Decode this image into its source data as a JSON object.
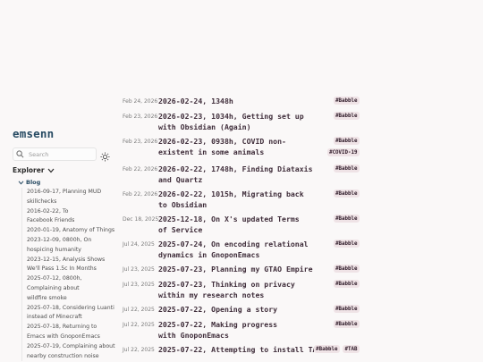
{
  "site": {
    "title": "emsenn"
  },
  "search": {
    "placeholder": "Search"
  },
  "icons": {
    "search": "search-icon",
    "darkmode": "sun-icon",
    "chevron": "chevron-down-icon"
  },
  "explorer": {
    "title": "Explorer",
    "folder": "Blog",
    "items": [
      "2016-09-17, Planning MUD",
      "skillchecks",
      "2016-02-22, To",
      "Facebook Friends",
      "2020-01-19, Anatomy of Things",
      "2023-12-09, 0800h, On",
      "hospicing humanity",
      "2023-12-15, Analysis Shows",
      "We'll Pass 1.5c In Months",
      "2025-07-12, 0800h,",
      "Complaining about",
      "wildfire smoke",
      "2025-07-18, Considering Luanti",
      "instead of Minecraft",
      "2025-07-18, Returning to",
      "Emacs with GnoponEmacs",
      "2025-07-19, Complaining about",
      "nearby construction noise"
    ]
  },
  "posts": [
    {
      "date": "Feb 24, 2026",
      "title_lines": [
        "2026-02-24, 1348h"
      ],
      "tags": [
        "#Babble"
      ]
    },
    {
      "date": "Feb 23, 2026",
      "title_lines": [
        "2026-02-23, 1034h, Getting set up",
        "with Obsidian (Again)"
      ],
      "tags": [
        "#Babble"
      ]
    },
    {
      "date": "Feb 23, 2026",
      "title_lines": [
        "2026-02-23, 0938h, COVID non-",
        "existent in some animals"
      ],
      "tags": [
        "#Babble",
        "#COVID-19"
      ]
    },
    {
      "date": "Feb 22, 2026",
      "title_lines": [
        "2026-02-22, 1748h, Finding Diataxis",
        "and Quartz"
      ],
      "tags": [
        "#Babble"
      ]
    },
    {
      "date": "Feb 22, 2026",
      "title_lines": [
        "2026-02-22, 1015h, Migrating back",
        "to Obsidian"
      ],
      "tags": [
        "#Babble"
      ]
    },
    {
      "date": "Dec 18, 2025",
      "title_lines": [
        "2025-12-18, On X's updated Terms",
        "of Service"
      ],
      "tags": [
        "#Babble"
      ]
    },
    {
      "date": "Jul 24, 2025",
      "title_lines": [
        "2025-07-24, On encoding relational",
        "dynamics in GnoponEmacs"
      ],
      "tags": [
        "#Babble"
      ]
    },
    {
      "date": "Jul 23, 2025",
      "title_lines": [
        "2025-07-23, Planning my GTAO Empire"
      ],
      "tags": [
        "#Babble"
      ]
    },
    {
      "date": "Jul 23, 2025",
      "title_lines": [
        "2025-07-23, Thinking on privacy",
        "within my research notes"
      ],
      "tags": [
        "#Babble"
      ]
    },
    {
      "date": "Jul 22, 2025",
      "title_lines": [
        "2025-07-22, Opening a story"
      ],
      "tags": [
        "#Babble"
      ]
    },
    {
      "date": "Jul 22, 2025",
      "title_lines": [
        "2025-07-22, Making progress",
        "with GnoponEmacs"
      ],
      "tags": [
        "#Babble"
      ]
    },
    {
      "date": "Jul 22, 2025",
      "title_lines": [
        "2025-07-22, Attempting to install TAB"
      ],
      "tags": [
        "#Babble",
        "#TAB"
      ]
    }
  ]
}
